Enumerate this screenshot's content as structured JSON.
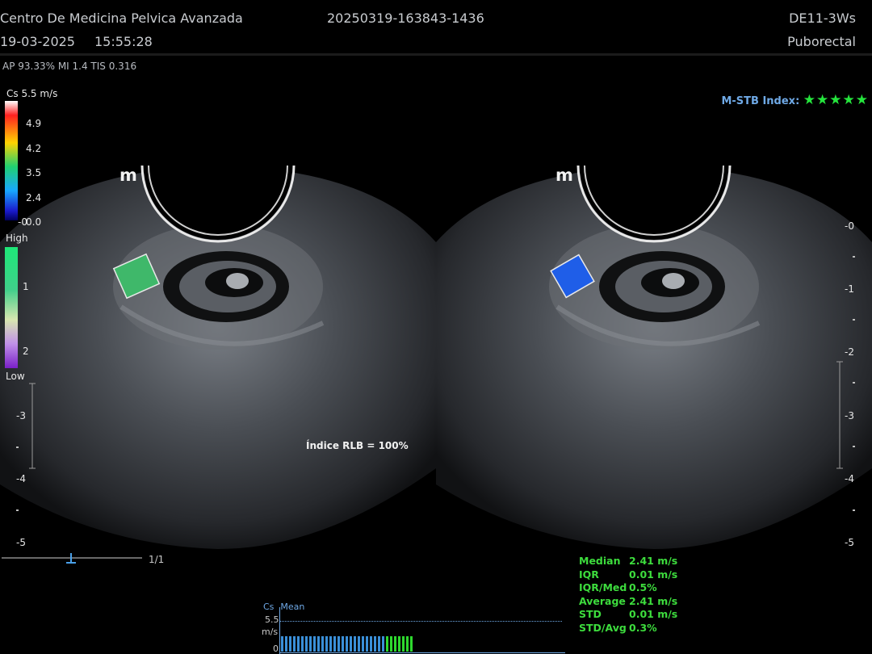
{
  "header": {
    "clinic": "Centro De Medicina Pelvica Avanzada",
    "exam_id": "20250319-163843-1436",
    "probe": "DE11-3Ws",
    "date": "19-03-2025",
    "time": "15:55:28",
    "preset": "Puborectal",
    "power": "AP 93.33%  MI 1.4 TIS 0.316"
  },
  "color_scale": {
    "unit_label": "Cs 5.5 m/s",
    "ticks": [
      "4.9",
      "4.2",
      "3.5",
      "2.4",
      "0.0"
    ],
    "zero_mark": "-0"
  },
  "quality_scale": {
    "high": "High",
    "low": "Low",
    "tick1": "1",
    "tick2": "2"
  },
  "depth_left": {
    "t3": "-3",
    "t4": "-4",
    "t5": "-5"
  },
  "depth_right": {
    "t0": "-0",
    "t1": "-1",
    "t2": "-2",
    "t3": "-3",
    "t4": "-4",
    "t5": "-5"
  },
  "msb": {
    "label": "M-STB Index:",
    "stars": "★★★★★"
  },
  "rlb": "Índice RLB = 100%",
  "frame": "1/1",
  "probe_mark": "m",
  "stats": [
    {
      "label": "Median",
      "value": "2.41 m/s"
    },
    {
      "label": "IQR",
      "value": "0.01 m/s"
    },
    {
      "label": "IQR/Med",
      "value": "0.5%"
    },
    {
      "label": "Average",
      "value": "2.41 m/s"
    },
    {
      "label": "STD",
      "value": "0.01 m/s"
    },
    {
      "label": "STD/Avg",
      "value": "0.3%"
    }
  ],
  "trend": {
    "title_cs": "Cs",
    "title_mean": "Mean",
    "ymax": "5.5",
    "unit": "m/s",
    "zero": "0",
    "blue_bars": 26,
    "green_bars": 7
  },
  "colors": {
    "roi_left": "#3fb86a",
    "roi_right": "#1f5ee8",
    "stats_green": "#3ddc3d",
    "accent_blue": "#6fa9e6"
  }
}
